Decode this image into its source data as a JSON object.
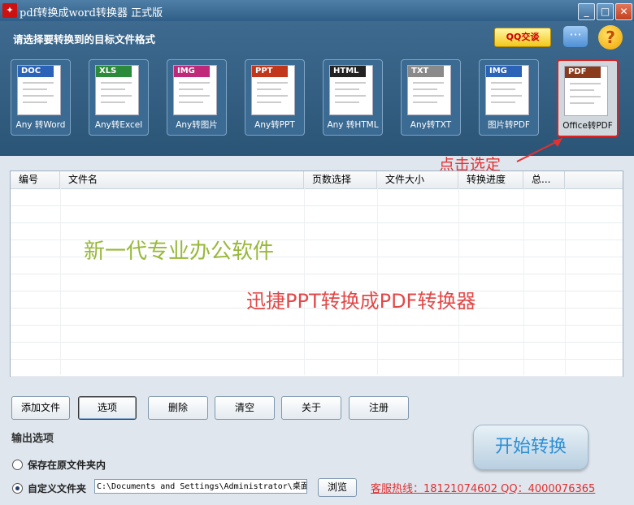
{
  "window": {
    "title": "pdf转换成word转换器 正式版",
    "app_icon": "pdf-app-icon",
    "minimize_icon": "minimize-icon",
    "maximize_icon": "maximize-icon",
    "close_icon": "close-icon"
  },
  "header": {
    "prompt": "请选择要转换到的目标文件格式",
    "qq_button": "QQ交谈",
    "chat_icon": "speech-bubble-icon",
    "help_icon": "question-mark-icon"
  },
  "formats": [
    {
      "badge": "DOC",
      "label": "Any 转Word",
      "color": "#2a63b8"
    },
    {
      "badge": "XLS",
      "label": "Any转Excel",
      "color": "#2b8b3a"
    },
    {
      "badge": "IMG",
      "label": "Any转图片",
      "color": "#c0287a"
    },
    {
      "badge": "PPT",
      "label": "Any转PPT",
      "color": "#c2361c"
    },
    {
      "badge": "HTML",
      "label": "Any 转HTML",
      "color": "#222222"
    },
    {
      "badge": "TXT",
      "label": "Any转TXT",
      "color": "#8a8a8a"
    },
    {
      "badge": "IMG",
      "label": "图片转PDF",
      "color": "#2a63b8"
    },
    {
      "badge": "PDF",
      "label": "Office转PDF",
      "color": "#8a3b1c"
    }
  ],
  "annotation": "点击选定",
  "table": {
    "columns": [
      "编号",
      "文件名",
      "页数选择",
      "文件大小",
      "转换进度",
      "总..."
    ],
    "rows": []
  },
  "watermark": {
    "line1": "新一代专业办公软件",
    "line2": "迅捷PPT转换成PDF转换器"
  },
  "buttons": {
    "add": "添加文件",
    "options": "选项",
    "delete": "删除",
    "clear": "清空",
    "about": "关于",
    "register": "注册"
  },
  "output": {
    "title": "输出选项",
    "option_original": "保存在原文件夹内",
    "option_custom": "自定义文件夹",
    "path": "C:\\Documents and Settings\\Administrator\\桌面",
    "browse": "浏览",
    "selected": "custom"
  },
  "hotline": "客服热线：18121074602 QQ：4000076365",
  "start_button": "开始转换",
  "colors": {
    "accent_red": "#e03030",
    "start_text": "#2b8fd6",
    "watermark_green": "#98b83a"
  }
}
